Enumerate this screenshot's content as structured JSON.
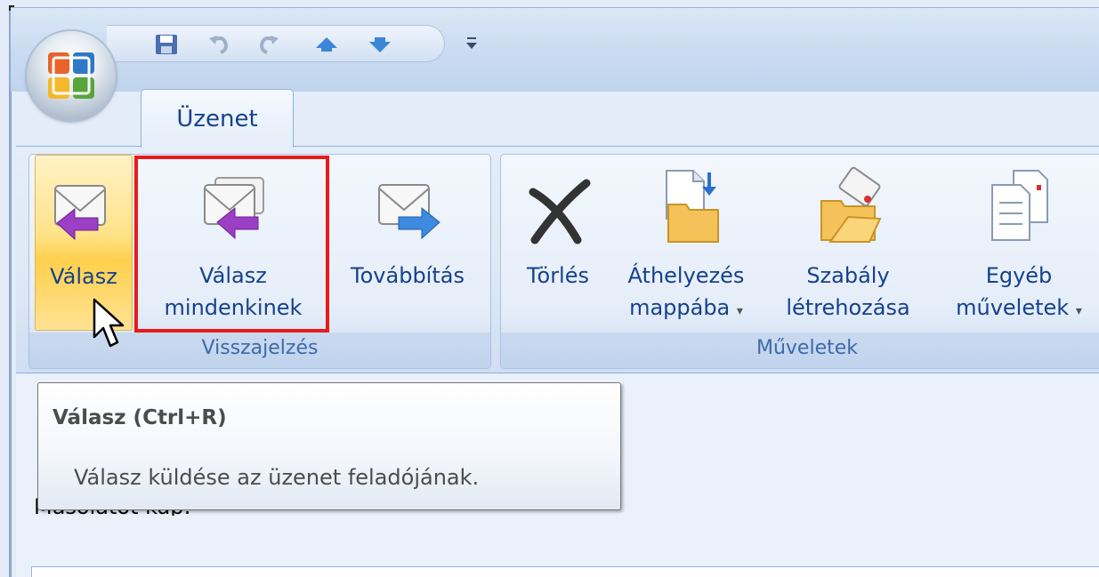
{
  "tab": {
    "label": "Üzenet"
  },
  "quick_access": {
    "buttons": [
      {
        "icon": "save-icon"
      },
      {
        "icon": "undo-icon"
      },
      {
        "icon": "redo-icon"
      },
      {
        "icon": "previous-item-icon"
      },
      {
        "icon": "next-item-icon"
      },
      {
        "icon": "customize-toolbar-icon"
      }
    ]
  },
  "groups": [
    {
      "name": "Visszajelzés",
      "buttons": [
        {
          "label": "Válasz",
          "icon": "reply-icon",
          "state": "hover"
        },
        {
          "label_line1": "Válasz",
          "label_line2": "mindenkinek",
          "icon": "reply-all-icon",
          "highlighted": true
        },
        {
          "label": "Továbbítás",
          "icon": "forward-icon"
        }
      ]
    },
    {
      "name": "Műveletek",
      "buttons": [
        {
          "label": "Törlés",
          "icon": "delete-icon"
        },
        {
          "label_line1": "Áthelyezés",
          "label_line2": "mappába",
          "dropdown": "▾",
          "icon": "move-to-folder-icon"
        },
        {
          "label_line1": "Szabály",
          "label_line2": "létrehozása",
          "icon": "create-rule-icon"
        },
        {
          "label_line1": "Egyéb",
          "label_line2": "műveletek",
          "dropdown": "▾",
          "icon": "other-actions-icon"
        }
      ]
    }
  ],
  "tooltip": {
    "title": "Válasz (Ctrl+R)",
    "body": "Válasz küldése az üzenet feladójának."
  },
  "document": {
    "partial_line": "Másolatot kap:"
  },
  "colors": {
    "highlight_box": "#e81b1b",
    "hover_button": "#ffd04d",
    "ribbon_text": "#15428b"
  }
}
